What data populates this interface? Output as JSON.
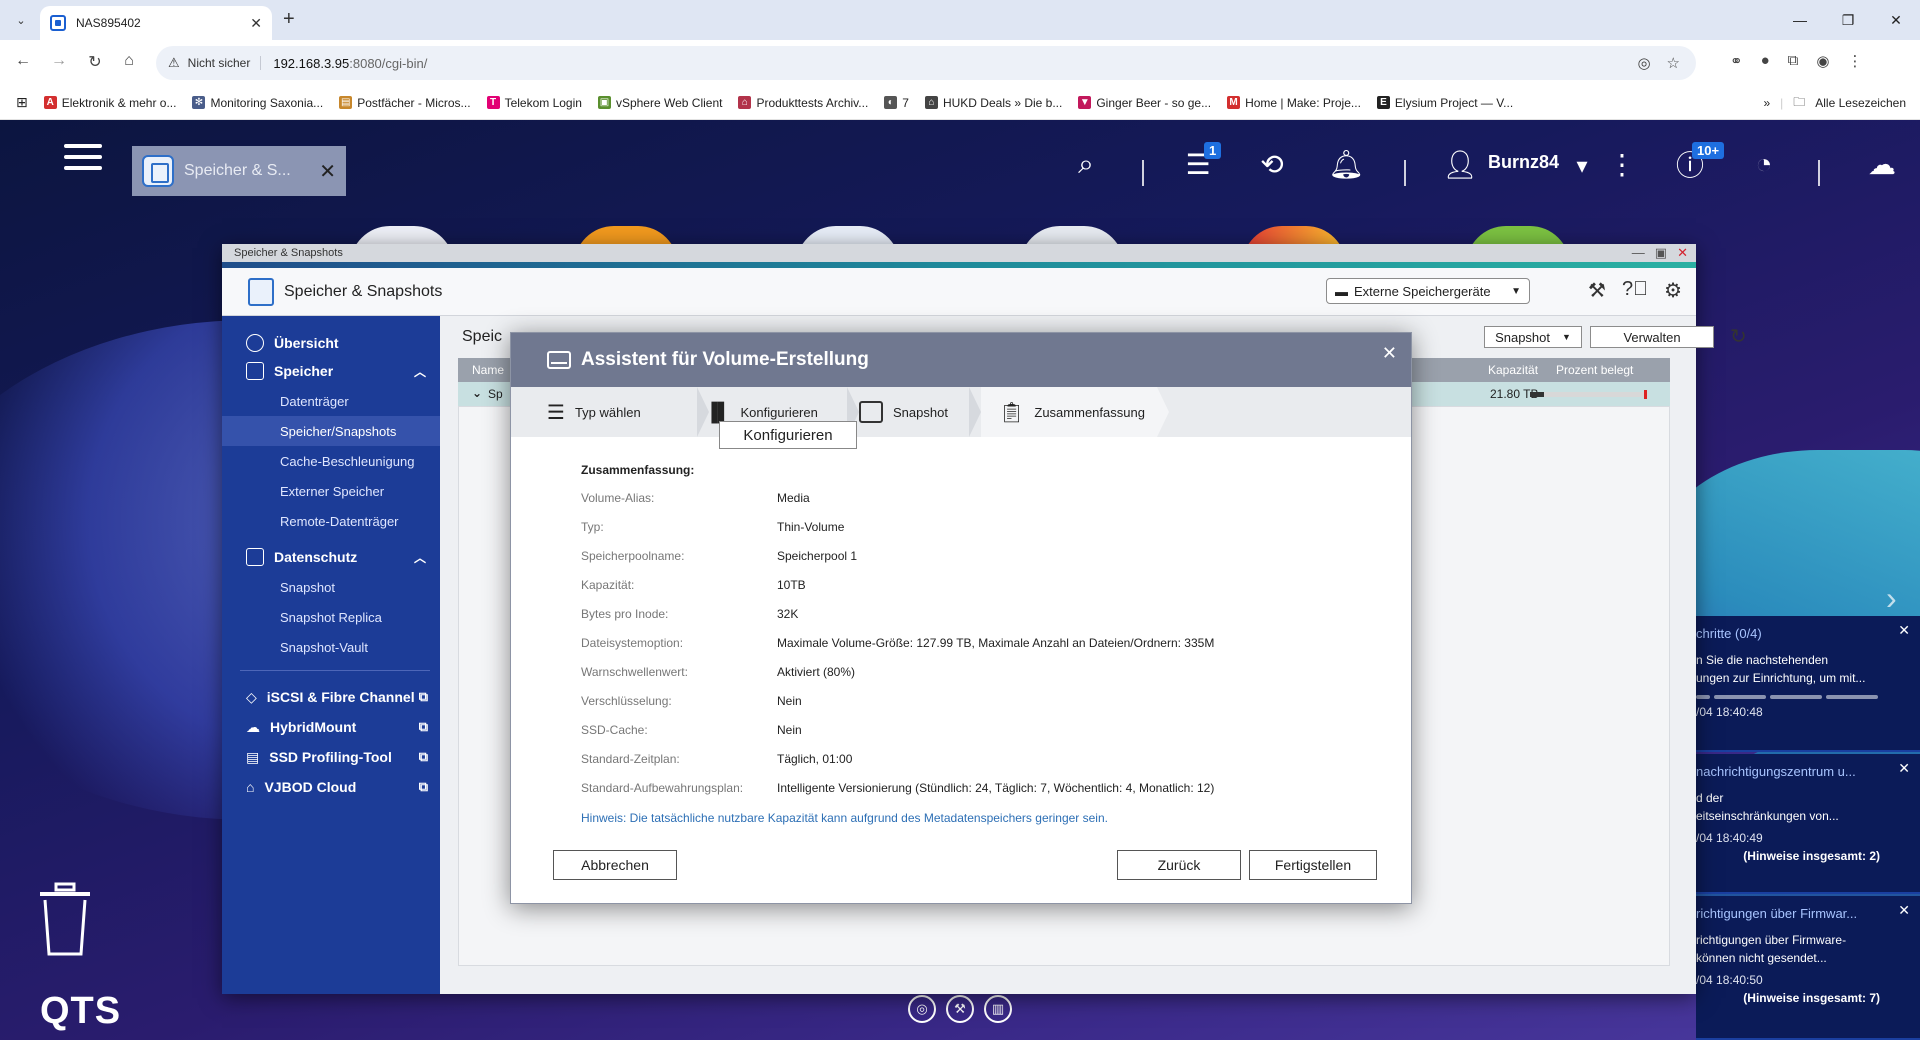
{
  "browser": {
    "tab_title": "NAS895402",
    "tab_close": "✕",
    "new_tab": "+",
    "not_secure": "Nicht sicher",
    "url_host": "192.168.3.95",
    "url_path": ":8080/cgi-bin/",
    "bookmarks": [
      {
        "label": "Elektronik & mehr o...",
        "color": "#d32f2f",
        "glyph": "A"
      },
      {
        "label": "Monitoring Saxonia...",
        "color": "#4a5d8a",
        "glyph": "✻"
      },
      {
        "label": "Postfächer - Micros...",
        "color": "#c7872c",
        "glyph": "▤"
      },
      {
        "label": "Telekom Login",
        "color": "#e20074",
        "glyph": "T"
      },
      {
        "label": "vSphere Web Client",
        "color": "#5a8f2e",
        "glyph": "▣"
      },
      {
        "label": "Produkttests Archiv...",
        "color": "#b2334a",
        "glyph": "⌂"
      },
      {
        "label": "7",
        "color": "#555555",
        "glyph": "◐"
      },
      {
        "label": "HUKD Deals » Die b...",
        "color": "#444444",
        "glyph": "⌂"
      },
      {
        "label": "Ginger Beer - so ge...",
        "color": "#c2185b",
        "glyph": "▼"
      },
      {
        "label": "Home | Make: Proje...",
        "color": "#d32f2f",
        "glyph": "M"
      },
      {
        "label": "Elysium Project — V...",
        "color": "#222222",
        "glyph": "E"
      }
    ],
    "bookmarks_more": "»",
    "all_bookmarks": "Alle Lesezeichen"
  },
  "qts": {
    "app_tab_title": "Speicher & S...",
    "task_badge": "1",
    "user_name": "Burnz84",
    "info_badge": "10+",
    "logo": "QTS"
  },
  "window": {
    "titlebar": "Speicher & Snapshots",
    "header_title": "Speicher & Snapshots",
    "external_devices": "Externe Speichergeräte",
    "content_title": "Speic",
    "snapshot_btn": "Snapshot",
    "manage_btn": "Verwalten",
    "table_head_name": "Name",
    "table_head_capacity": "Kapazität",
    "table_head_used": "Prozent belegt",
    "row_name": "Sp",
    "row_capacity": "21.80 TB",
    "row_used_fraction": 0.12
  },
  "sidebar": {
    "overview": "Übersicht",
    "storage": "Speicher",
    "storage_items": [
      "Datenträger",
      "Speicher/Snapshots",
      "Cache-Beschleunigung",
      "Externer Speicher",
      "Remote-Datenträger"
    ],
    "protection": "Datenschutz",
    "protection_items": [
      "Snapshot",
      "Snapshot Replica",
      "Snapshot-Vault"
    ],
    "extra_items": [
      "iSCSI & Fibre Channel",
      "HybridMount",
      "SSD Profiling-Tool",
      "VJBOD Cloud"
    ]
  },
  "wizard": {
    "title": "Assistent für Volume-Erstellung",
    "steps": [
      "Typ wählen",
      "Konfigurieren",
      "Snapshot",
      "Zusammenfassung"
    ],
    "tooltip": "Konfigurieren",
    "summary_heading": "Zusammenfassung:",
    "rows": [
      {
        "key": "Volume-Alias:",
        "value": "Media"
      },
      {
        "key": "Typ:",
        "value": "Thin-Volume"
      },
      {
        "key": "Speicherpoolname:",
        "value": "Speicherpool 1"
      },
      {
        "key": "Kapazität:",
        "value": "10TB"
      },
      {
        "key": "Bytes pro Inode:",
        "value": "32K"
      },
      {
        "key": "Dateisystemoption:",
        "value": "Maximale Volume-Größe: 127.99 TB, Maximale Anzahl an Dateien/Ordnern: 335M"
      },
      {
        "key": "Warnschwellenwert:",
        "value": "Aktiviert (80%)"
      },
      {
        "key": "Verschlüsselung:",
        "value": "Nein"
      },
      {
        "key": "SSD-Cache:",
        "value": "Nein"
      },
      {
        "key": "Standard-Zeitplan:",
        "value": "Täglich, 01:00"
      },
      {
        "key": "Standard-Aufbewahrungsplan:",
        "value": "Intelligente Versionierung (Stündlich: 24, Täglich: 7, Wöchentlich: 4, Monatlich: 12)"
      }
    ],
    "hint": "Hinweis: Die tatsächliche nutzbare Kapazität kann aufgrund des Metadatenspeichers geringer sein.",
    "cancel": "Abbrechen",
    "back": "Zurück",
    "finish": "Fertigstellen"
  },
  "notifications": [
    {
      "title": "chritte (0/4)",
      "body1": "n Sie die nachstehenden",
      "body2": "ungen zur Einrichtung, um mit...",
      "time": "/04 18:40:48",
      "total": ""
    },
    {
      "title": "nachrichtigungszentrum u...",
      "body1": "d der",
      "body2": "eitseinschränkungen von...",
      "time": "/04 18:40:49",
      "total": "(Hinweise insgesamt: 2)"
    },
    {
      "title": "richtigungen über Firmwar...",
      "body1": "richtigungen über Firmware-",
      "body2": "können nicht gesendet...",
      "time": "/04 18:40:50",
      "total": "(Hinweise insgesamt: 7)"
    }
  ]
}
